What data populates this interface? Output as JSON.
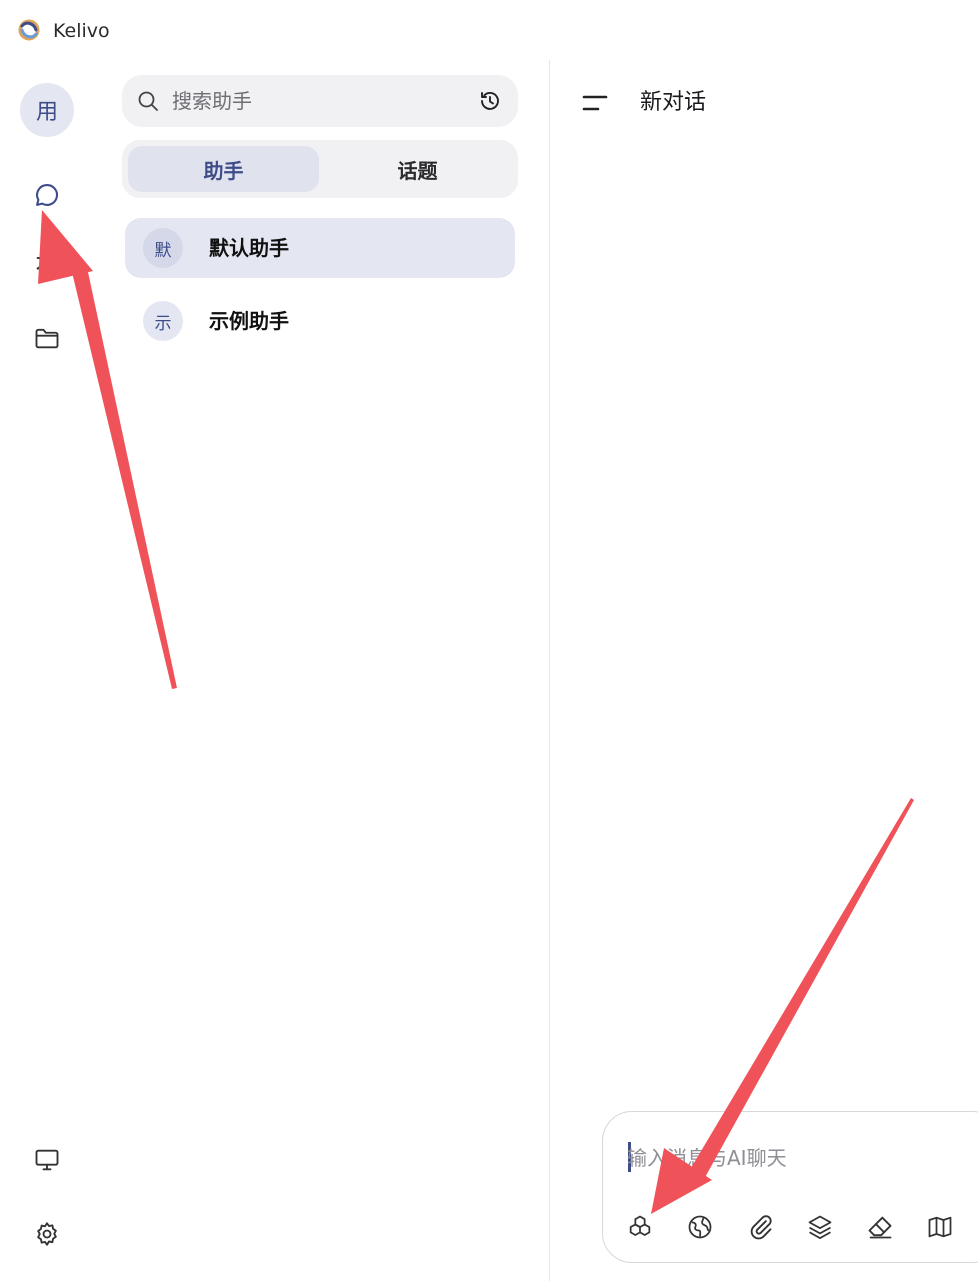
{
  "window": {
    "app_title": "Kelivo"
  },
  "rail": {
    "avatar_text": "用",
    "items": [
      {
        "name": "chat",
        "icon": "chat-bubble-icon",
        "active": true
      },
      {
        "name": "translate",
        "icon": "translate-icon"
      },
      {
        "name": "files",
        "icon": "folder-icon"
      },
      {
        "name": "display",
        "icon": "monitor-icon"
      },
      {
        "name": "settings",
        "icon": "gear-icon"
      }
    ]
  },
  "sidebar": {
    "search": {
      "placeholder": "搜索助手"
    },
    "tabs": [
      {
        "label": "助手",
        "active": true
      },
      {
        "label": "话题",
        "active": false
      }
    ],
    "assistants": [
      {
        "avatar": "默",
        "name": "默认助手",
        "selected": true
      },
      {
        "avatar": "示",
        "name": "示例助手",
        "selected": false
      }
    ]
  },
  "chat": {
    "title": "新对话",
    "composer": {
      "placeholder": "输入消息与AI聊天",
      "tools": [
        "model-select-icon",
        "globe-icon",
        "paperclip-icon",
        "layers-icon",
        "eraser-icon",
        "map-icon"
      ]
    }
  },
  "colors": {
    "accent": "#3e4d8a",
    "selected_bg": "#e4e6f1",
    "panel_bg": "#f1f1f3",
    "annotation_arrow": "#f0525a"
  }
}
